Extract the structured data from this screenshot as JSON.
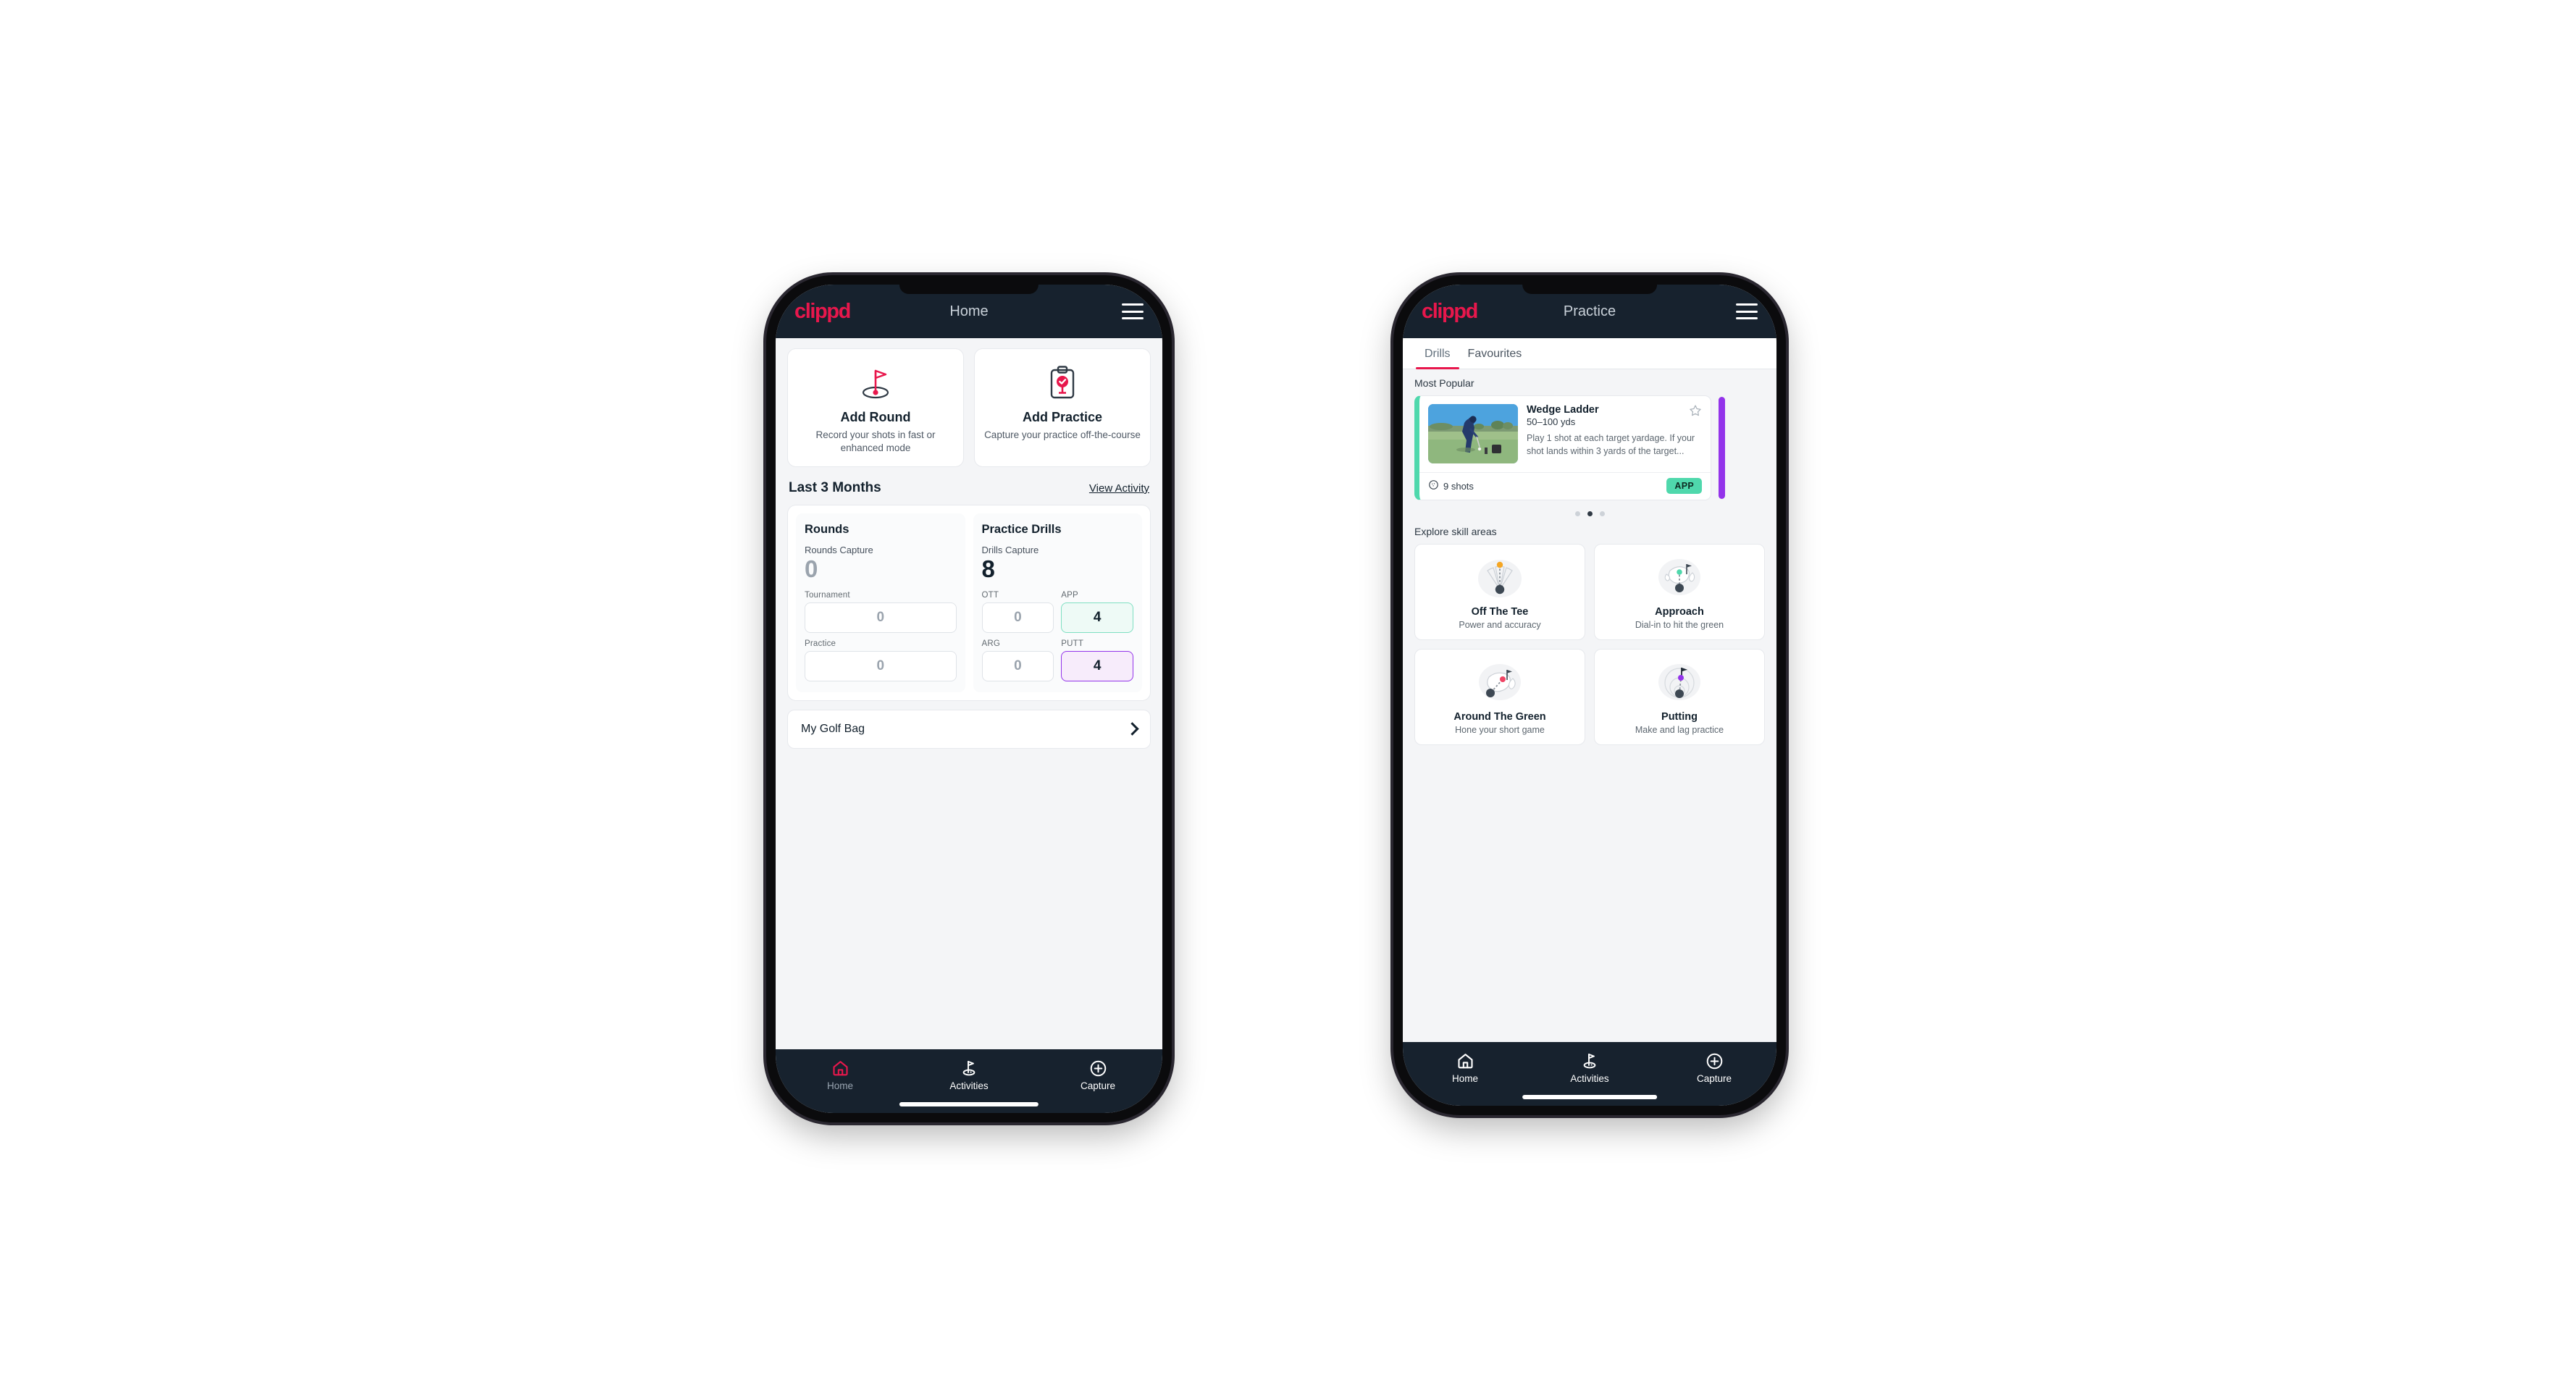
{
  "brand": {
    "logo_text": "clippd",
    "accent_pink": "#e8174c",
    "dark_navy": "#17222e",
    "mint_green": "#4fd8ac",
    "purple": "#9333ea"
  },
  "phone_home": {
    "appbar": {
      "title": "Home",
      "logo": "clippd",
      "menu_icon": "hamburger-icon"
    },
    "actions": [
      {
        "icon": "golf-flag-hole-icon",
        "title": "Add Round",
        "subtitle": "Record your shots in fast or enhanced mode"
      },
      {
        "icon": "clipboard-check-icon",
        "title": "Add Practice",
        "subtitle": "Capture your practice off-the-course"
      }
    ],
    "section": {
      "title": "Last 3 Months",
      "link": "View Activity"
    },
    "stats": [
      {
        "heading": "Rounds",
        "capture_label": "Rounds Capture",
        "capture_value": "0",
        "capture_is_zero": true,
        "metrics": [
          {
            "label": "Tournament",
            "value": "0",
            "style": "plain"
          },
          {
            "label": "Practice",
            "value": "0",
            "style": "plain"
          }
        ]
      },
      {
        "heading": "Practice Drills",
        "capture_label": "Drills Capture",
        "capture_value": "8",
        "capture_is_zero": false,
        "metrics": [
          {
            "label": "OTT",
            "value": "0",
            "style": "plain"
          },
          {
            "label": "APP",
            "value": "4",
            "style": "green"
          },
          {
            "label": "ARG",
            "value": "0",
            "style": "plain"
          },
          {
            "label": "PUTT",
            "value": "4",
            "style": "purple"
          }
        ]
      }
    ],
    "golf_bag": {
      "label": "My Golf Bag",
      "chevron": "chevron-right-icon"
    },
    "bottom_nav": [
      {
        "label": "Home",
        "icon": "home-icon",
        "active": true
      },
      {
        "label": "Activities",
        "icon": "golf-flag-icon",
        "active": false
      },
      {
        "label": "Capture",
        "icon": "plus-circle-icon",
        "active": false
      }
    ]
  },
  "phone_practice": {
    "appbar": {
      "title": "Practice",
      "logo": "clippd",
      "menu_icon": "hamburger-icon"
    },
    "tabs": [
      {
        "label": "Drills",
        "active": true
      },
      {
        "label": "Favourites",
        "active": false
      }
    ],
    "most_popular_label": "Most Popular",
    "drill": {
      "title": "Wedge Ladder",
      "yardage": "50–100 yds",
      "description": "Play 1 shot at each target yardage. If your shot lands within 3 yards of the target...",
      "shots": "9 shots",
      "badge": "APP",
      "favourite_icon": "star-outline-icon",
      "shots_icon": "golf-ball-icon",
      "accent": "#4fd8ac",
      "thumb_alt": "golfer-chipping-photo"
    },
    "carousel_dots": {
      "count": 3,
      "active_index": 1
    },
    "explore_label": "Explore skill areas",
    "skill_areas": [
      {
        "title": "Off The Tee",
        "subtitle": "Power and accuracy",
        "art": "tee-fan-icon",
        "dot_color": "#f5a623"
      },
      {
        "title": "Approach",
        "subtitle": "Dial-in to hit the green",
        "art": "green-approach-icon",
        "dot_color": "#4fd8ac"
      },
      {
        "title": "Around The Green",
        "subtitle": "Hone your short game",
        "art": "chip-green-icon",
        "dot_color": "#ef4464"
      },
      {
        "title": "Putting",
        "subtitle": "Make and lag practice",
        "art": "putting-rings-icon",
        "dot_color": "#9333ea"
      }
    ],
    "bottom_nav": [
      {
        "label": "Home",
        "icon": "home-icon",
        "active": false
      },
      {
        "label": "Activities",
        "icon": "golf-flag-icon",
        "active": false
      },
      {
        "label": "Capture",
        "icon": "plus-circle-icon",
        "active": false
      }
    ]
  }
}
